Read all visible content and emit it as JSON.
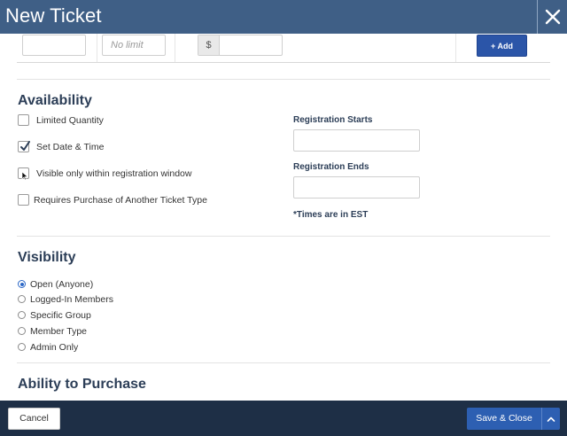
{
  "window": {
    "title": "New Ticket",
    "close_icon": "close-icon"
  },
  "ticket_row": {
    "quantity_value": "",
    "limit_placeholder": "No limit",
    "currency_symbol": "$",
    "price_value": "",
    "add_label": "+ Add"
  },
  "availability": {
    "heading": "Availability",
    "options": [
      {
        "label": "Limited Quantity",
        "checked": false
      },
      {
        "label": "Set Date & Time",
        "checked": true
      },
      {
        "label": "Visible only within registration window",
        "checked": false
      },
      {
        "label": "Requires Purchase of Another Ticket Type",
        "checked": false
      }
    ],
    "registration_starts_label": "Registration Starts",
    "registration_starts_value": "",
    "registration_ends_label": "Registration Ends",
    "registration_ends_value": "",
    "timezone_note": "*Times are in EST"
  },
  "visibility": {
    "heading": "Visibility",
    "options": [
      {
        "label": "Open (Anyone)",
        "selected": true
      },
      {
        "label": "Logged-In Members",
        "selected": false
      },
      {
        "label": "Specific Group",
        "selected": false
      },
      {
        "label": "Member Type",
        "selected": false
      },
      {
        "label": "Admin Only",
        "selected": false
      }
    ]
  },
  "ability_to_purchase": {
    "heading": "Ability to Purchase"
  },
  "footer": {
    "cancel_label": "Cancel",
    "save_label": "Save & Close",
    "caret_icon": "chevron-up-icon"
  },
  "colors": {
    "titlebar": "#3f5f86",
    "footer": "#1e2f46",
    "primary_button": "#2d5fb2",
    "heading_text": "#2c3e57"
  }
}
